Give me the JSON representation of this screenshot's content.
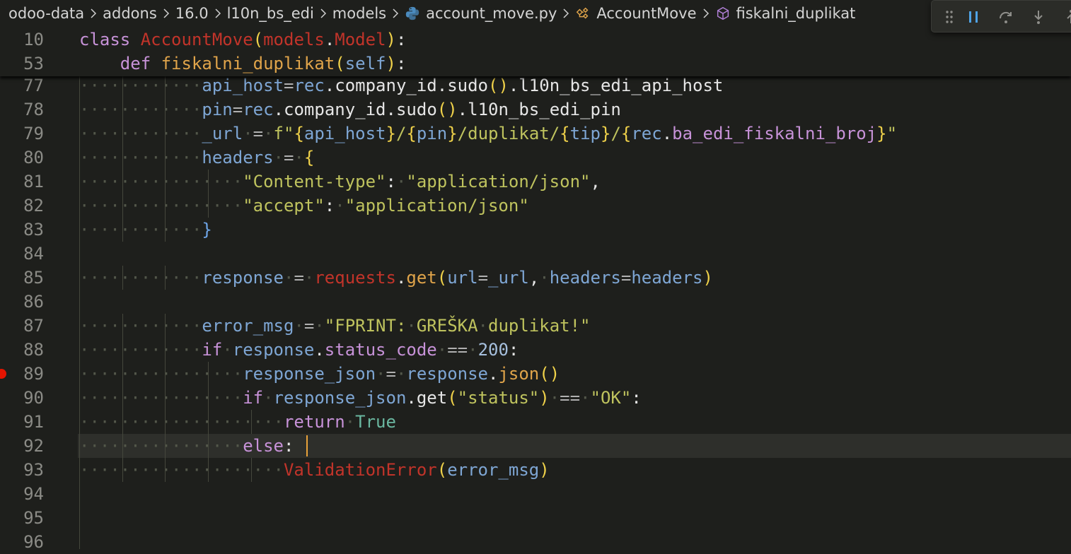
{
  "breadcrumb": {
    "items": [
      {
        "label": "odoo-data",
        "icon": ""
      },
      {
        "label": "addons",
        "icon": ""
      },
      {
        "label": "16.0",
        "icon": ""
      },
      {
        "label": "l10n_bs_edi",
        "icon": ""
      },
      {
        "label": "models",
        "icon": ""
      },
      {
        "label": "account_move.py",
        "icon": "python-file-icon"
      },
      {
        "label": "AccountMove",
        "icon": "class-symbol-icon"
      },
      {
        "label": "fiskalni_duplikat",
        "icon": "method-symbol-icon"
      }
    ],
    "separator_icon": "chevron-right-icon"
  },
  "debug_toolbar": {
    "buttons": [
      "drag-handle-icon",
      "pause-icon",
      "step-over-icon",
      "step-into-icon",
      "step-out-icon"
    ]
  },
  "sticky_scroll": [
    {
      "number": "10",
      "code": "class AccountMove(models.Model):"
    },
    {
      "number": "53",
      "code": "    def fiskalni_duplikat(self):"
    }
  ],
  "editor": {
    "lines": [
      {
        "number": "77",
        "code": "            api_host=rec.company_id.sudo().l10n_bs_edi_api_host"
      },
      {
        "number": "78",
        "code": "            pin=rec.company_id.sudo().l10n_bs_edi_pin"
      },
      {
        "number": "79",
        "code": "            _url = f\"{api_host}/{pin}/duplikat/{tip}/{rec.ba_edi_fiskalni_broj}\""
      },
      {
        "number": "80",
        "code": "            headers = {"
      },
      {
        "number": "81",
        "code": "                \"Content-type\": \"application/json\","
      },
      {
        "number": "82",
        "code": "                \"accept\": \"application/json\""
      },
      {
        "number": "83",
        "code": "            }"
      },
      {
        "number": "84",
        "code": ""
      },
      {
        "number": "85",
        "code": "            response = requests.get(url=_url, headers=headers)"
      },
      {
        "number": "86",
        "code": ""
      },
      {
        "number": "87",
        "code": "            error_msg = \"FPRINT: GREŠKA duplikat!\""
      },
      {
        "number": "88",
        "code": "            if response.status_code == 200:"
      },
      {
        "number": "89",
        "code": "                response_json = response.json()"
      },
      {
        "number": "90",
        "code": "                if response_json.get(\"status\") == \"OK\":"
      },
      {
        "number": "91",
        "code": "                    return True"
      },
      {
        "number": "92",
        "code": "                else:"
      },
      {
        "number": "93",
        "code": "                    ValidationError(error_msg)"
      },
      {
        "number": "94",
        "code": ""
      },
      {
        "number": "95",
        "code": ""
      },
      {
        "number": "96",
        "code": ""
      }
    ],
    "current_line": "92",
    "breakpoint_line": "89"
  },
  "colors": {
    "background": "#1e1f1c",
    "keyword": "#c792d8",
    "function": "#e0a44a",
    "class": "#c2342a",
    "variable": "#7ea6d4",
    "string": "#bfc35e",
    "breakpoint": "#e51400",
    "debug_accent": "#4fa3e6"
  }
}
